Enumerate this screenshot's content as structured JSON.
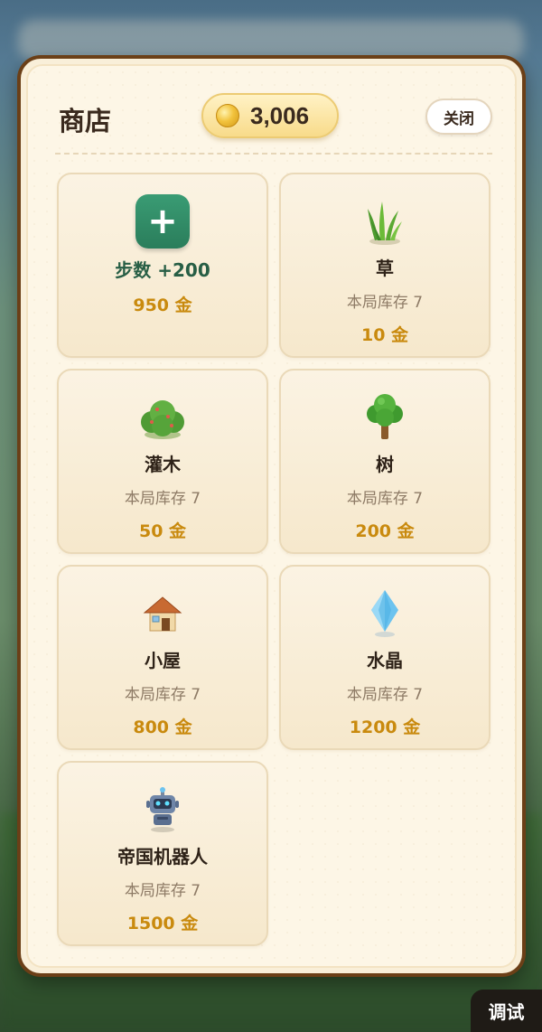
{
  "shop": {
    "title": "商店",
    "coins": "3,006",
    "close_label": "关闭"
  },
  "items": [
    {
      "name": "步数 +200",
      "stock": "",
      "price": "950 金",
      "icon": "plus-icon"
    },
    {
      "name": "草",
      "stock": "本局库存 7",
      "price": "10 金",
      "icon": "grass-icon"
    },
    {
      "name": "灌木",
      "stock": "本局库存 7",
      "price": "50 金",
      "icon": "bush-icon"
    },
    {
      "name": "树",
      "stock": "本局库存 7",
      "price": "200 金",
      "icon": "tree-icon"
    },
    {
      "name": "小屋",
      "stock": "本局库存 7",
      "price": "800 金",
      "icon": "house-icon"
    },
    {
      "name": "水晶",
      "stock": "本局库存 7",
      "price": "1200 金",
      "icon": "crystal-icon"
    },
    {
      "name": "帝国机器人",
      "stock": "本局库存 7",
      "price": "1500 金",
      "icon": "robot-icon"
    }
  ],
  "debug_label": "调试",
  "colors": {
    "panel_border": "#6b3f17",
    "price": "#c98a0e",
    "accent_green": "#2a7d5b"
  }
}
